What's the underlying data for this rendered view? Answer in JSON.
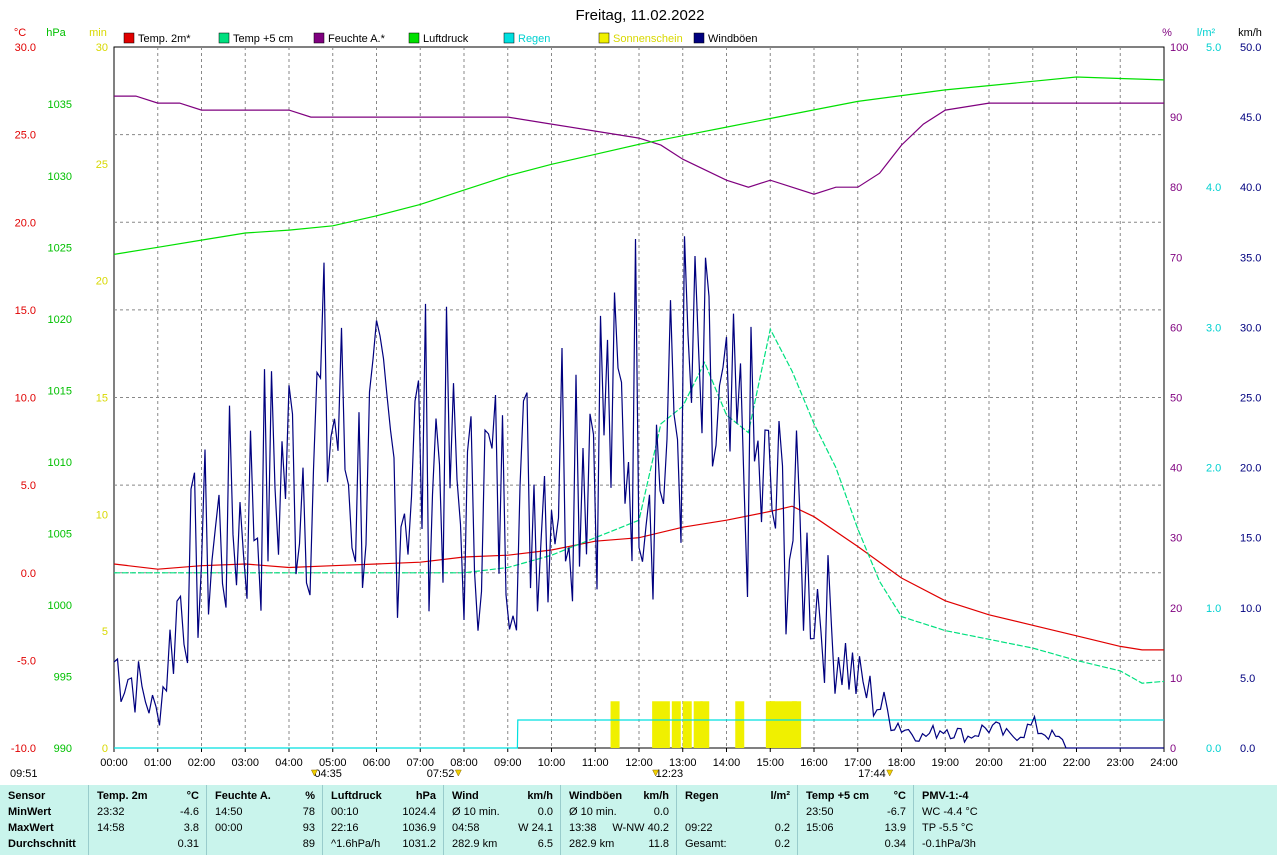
{
  "title": "Freitag, 11.02.2022",
  "axis_units": {
    "temp": "°C",
    "press": "hPa",
    "sun": "min",
    "hum": "%",
    "rain": "l/m²",
    "wind": "km/h"
  },
  "legend": [
    {
      "label": "Temp. 2m*",
      "color": "#e00000"
    },
    {
      "label": "Temp +5 cm",
      "color": "#00e07f"
    },
    {
      "label": "Feuchte A.*",
      "color": "#7f007f"
    },
    {
      "label": "Luftdruck",
      "color": "#00e000"
    },
    {
      "label": "Regen",
      "color": "#00e0e0"
    },
    {
      "label": "Sonnenschein",
      "color": "#f0f000"
    },
    {
      "label": "Windböen",
      "color": "#00007f"
    }
  ],
  "time_markers": {
    "bottom_left": "09:51",
    "sunrise_dawn": "04:35",
    "sunrise": "07:52",
    "noon": "12:23",
    "sunset": "17:44"
  },
  "chart_data": {
    "type": "line",
    "title": "Freitag, 11.02.2022",
    "x_ticks": [
      "00:00",
      "01:00",
      "02:00",
      "03:00",
      "04:00",
      "05:00",
      "06:00",
      "07:00",
      "08:00",
      "09:00",
      "10:00",
      "11:00",
      "12:00",
      "13:00",
      "14:00",
      "15:00",
      "16:00",
      "17:00",
      "18:00",
      "19:00",
      "20:00",
      "21:00",
      "22:00",
      "23:00",
      "24:00"
    ],
    "axes": {
      "temp": {
        "min": -10,
        "max": 30,
        "ticks": [
          "30.0",
          "25.0",
          "20.0",
          "15.0",
          "10.0",
          "5.0",
          "0.0",
          "-5.0",
          "-10.0"
        ],
        "color": "#e00000"
      },
      "press": {
        "min": 990,
        "max": 1039,
        "ticks": [
          "1035",
          "1030",
          "1025",
          "1020",
          "1015",
          "1010",
          "1005",
          "1000",
          "995",
          "990"
        ],
        "color": "#00c000"
      },
      "sun": {
        "min": 0,
        "max": 30,
        "ticks": [
          "30",
          "25",
          "20",
          "15",
          "10",
          "5",
          "0"
        ],
        "color": "#d8d800"
      },
      "hum": {
        "min": 0,
        "max": 100,
        "ticks": [
          "100",
          "90",
          "80",
          "70",
          "60",
          "50",
          "40",
          "30",
          "20",
          "10",
          "0"
        ],
        "color": "#7f007f"
      },
      "rain": {
        "min": 0,
        "max": 5,
        "ticks": [
          "5.0",
          "4.0",
          "3.0",
          "2.0",
          "1.0",
          "0.0"
        ],
        "color": "#00d0d0"
      },
      "wind": {
        "min": 0,
        "max": 50,
        "ticks": [
          "50.0",
          "45.0",
          "40.0",
          "35.0",
          "30.0",
          "25.0",
          "20.0",
          "15.0",
          "10.0",
          "5.0",
          "0.0"
        ],
        "color": "#00007f"
      }
    },
    "series": [
      {
        "name": "Temp. 2m*",
        "axis": "temp",
        "color": "#e00000",
        "x": [
          0,
          1,
          2,
          3,
          4,
          5,
          6,
          7,
          8,
          9,
          10,
          11,
          12,
          13,
          14,
          15,
          15.5,
          16,
          17,
          18,
          19,
          20,
          21,
          22,
          23,
          23.5,
          24
        ],
        "y": [
          0.5,
          0.2,
          0.4,
          0.5,
          0.3,
          0.4,
          0.5,
          0.6,
          0.9,
          1.0,
          1.3,
          1.8,
          2.0,
          2.6,
          3.0,
          3.5,
          3.8,
          3.2,
          1.5,
          -0.3,
          -1.6,
          -2.4,
          -3.0,
          -3.6,
          -4.2,
          -4.4,
          -4.4
        ]
      },
      {
        "name": "Temp +5 cm",
        "axis": "temp",
        "color": "#00e07f",
        "x": [
          0,
          1,
          2,
          3,
          4,
          5,
          6,
          7,
          8,
          9,
          10,
          11,
          12,
          12.5,
          13,
          13.5,
          14,
          14.5,
          15,
          15.5,
          16,
          16.5,
          17,
          17.5,
          18,
          19,
          20,
          21,
          22,
          23,
          23.5,
          24
        ],
        "y": [
          0.0,
          0.0,
          0.0,
          0.0,
          0.0,
          0.0,
          0.0,
          0.0,
          0.0,
          0.3,
          1.0,
          2.0,
          3.0,
          8.5,
          9.5,
          12.0,
          9.0,
          8.0,
          13.9,
          11.5,
          8.5,
          6.0,
          2.5,
          -0.5,
          -2.5,
          -3.3,
          -3.8,
          -4.3,
          -5.0,
          -5.6,
          -6.3,
          -6.2
        ]
      },
      {
        "name": "Feuchte A.*",
        "axis": "hum",
        "color": "#7f007f",
        "x": [
          0,
          0.5,
          1,
          1.5,
          2,
          3,
          4,
          4.5,
          5,
          6,
          7,
          8,
          9,
          10,
          11,
          12,
          12.5,
          13,
          14,
          14.5,
          15,
          15.5,
          16,
          16.5,
          17,
          17.5,
          18,
          18.5,
          19,
          20,
          21,
          22,
          23,
          24
        ],
        "y": [
          93,
          93,
          92,
          92,
          91,
          91,
          91,
          90,
          90,
          90,
          90,
          90,
          90,
          89,
          88,
          87,
          86,
          84,
          81,
          80,
          81,
          80,
          79,
          80,
          80,
          82,
          86,
          89,
          91,
          92,
          92,
          92,
          92,
          92
        ]
      },
      {
        "name": "Luftdruck",
        "axis": "press",
        "color": "#00e000",
        "x": [
          0,
          1,
          2,
          3,
          4,
          5,
          6,
          7,
          8,
          9,
          10,
          11,
          12,
          13,
          14,
          15,
          16,
          17,
          18,
          19,
          20,
          21,
          22,
          23,
          24
        ],
        "y": [
          1024.5,
          1025.0,
          1025.5,
          1026.0,
          1026.2,
          1026.5,
          1027.2,
          1028.0,
          1029.0,
          1030.0,
          1030.8,
          1031.5,
          1032.2,
          1032.8,
          1033.4,
          1034.0,
          1034.6,
          1035.2,
          1035.6,
          1036.0,
          1036.3,
          1036.6,
          1036.9,
          1036.8,
          1036.7
        ]
      },
      {
        "name": "Regen",
        "axis": "rain",
        "color": "#00e0e0",
        "x": [
          0,
          9.22,
          9.23,
          24
        ],
        "y": [
          0,
          0,
          0.2,
          0.2
        ]
      },
      {
        "name": "Windböen",
        "axis": "wind",
        "color": "#00007f",
        "x": [
          0,
          0.5,
          1,
          1.5,
          2,
          2.5,
          3,
          3.5,
          4,
          4.5,
          5,
          5.5,
          6,
          6.5,
          7,
          7.5,
          8,
          8.5,
          9,
          9.5,
          10,
          10.5,
          11,
          11.5,
          12,
          12.5,
          13,
          13.5,
          14,
          14.5,
          15,
          15.5,
          16,
          16.5,
          17,
          17.5,
          18,
          18.5,
          19,
          19.5,
          20,
          20.5,
          21,
          21.5,
          22,
          23,
          24
        ],
        "y": [
          8,
          6,
          3,
          14,
          18,
          20,
          22,
          24,
          26,
          28,
          31,
          24,
          26,
          25,
          27,
          28,
          20,
          24,
          22,
          24,
          26,
          30,
          32,
          28,
          34,
          25,
          33,
          30,
          26,
          26,
          22,
          20,
          15,
          10,
          6,
          4,
          2,
          1,
          2,
          1,
          2,
          1,
          2,
          1,
          0,
          0,
          0
        ]
      },
      {
        "name": "Sonnenschein",
        "axis": "sun",
        "color": "#f0f000",
        "x": [
          11.35,
          12.3,
          12.5,
          12.75,
          13.0,
          13.25,
          13.4,
          14.2,
          14.9,
          15.0,
          15.2,
          15.4,
          15.5
        ],
        "y": [
          2,
          2,
          2,
          2,
          2,
          2,
          2,
          2,
          2,
          2,
          2,
          2,
          2
        ]
      }
    ]
  },
  "stats": {
    "columns": [
      {
        "header": [
          "Sensor",
          "",
          ""
        ],
        "rows": [
          [
            "MinWert",
            "",
            ""
          ],
          [
            "MaxWert",
            "",
            ""
          ],
          [
            "Durchschnitt",
            "",
            ""
          ]
        ]
      },
      {
        "header": [
          "Temp. 2m",
          "°C",
          ""
        ],
        "rows": [
          [
            "23:32",
            "",
            "-4.6"
          ],
          [
            "14:58",
            "",
            "3.8"
          ],
          [
            "",
            "",
            "0.31"
          ]
        ]
      },
      {
        "header": [
          "Feuchte A.",
          "%",
          ""
        ],
        "rows": [
          [
            "14:50",
            "",
            "78"
          ],
          [
            "00:00",
            "",
            "93"
          ],
          [
            "",
            "",
            "89"
          ]
        ]
      },
      {
        "header": [
          "Luftdruck",
          "hPa",
          ""
        ],
        "rows": [
          [
            "00:10",
            "",
            "1024.4"
          ],
          [
            "22:16",
            "",
            "1036.9"
          ],
          [
            "^1.6hPa/h",
            "",
            "1031.2"
          ]
        ]
      },
      {
        "header": [
          "Wind",
          "km/h",
          ""
        ],
        "rows": [
          [
            "Ø 10 min.",
            "",
            "0.0"
          ],
          [
            "04:58",
            "W 24.1",
            ""
          ],
          [
            "282.9 km",
            "",
            "6.5"
          ]
        ]
      },
      {
        "header": [
          "Windböen",
          "km/h",
          ""
        ],
        "rows": [
          [
            "Ø 10 min.",
            "",
            "0.0"
          ],
          [
            "13:38",
            "W-NW 40.2",
            ""
          ],
          [
            "282.9 km",
            "",
            "11.8"
          ]
        ]
      },
      {
        "header": [
          "Regen",
          "l/m²",
          ""
        ],
        "rows": [
          [
            "",
            "",
            ""
          ],
          [
            "09:22",
            "",
            "0.2"
          ],
          [
            "Gesamt:",
            "",
            "0.2"
          ]
        ]
      },
      {
        "header": [
          "Temp +5 cm",
          "°C",
          ""
        ],
        "rows": [
          [
            "23:50",
            "",
            "-6.7"
          ],
          [
            "15:06",
            "",
            "13.9"
          ],
          [
            "",
            "",
            "0.34"
          ]
        ]
      },
      {
        "header": [
          "PMV-1:-4",
          "",
          ""
        ],
        "rows": [
          [
            "WC -4.4 °C",
            "",
            ""
          ],
          [
            "TP -5.5 °C",
            "",
            ""
          ],
          [
            "-0.1hPa/3h",
            "",
            ""
          ]
        ]
      }
    ]
  }
}
